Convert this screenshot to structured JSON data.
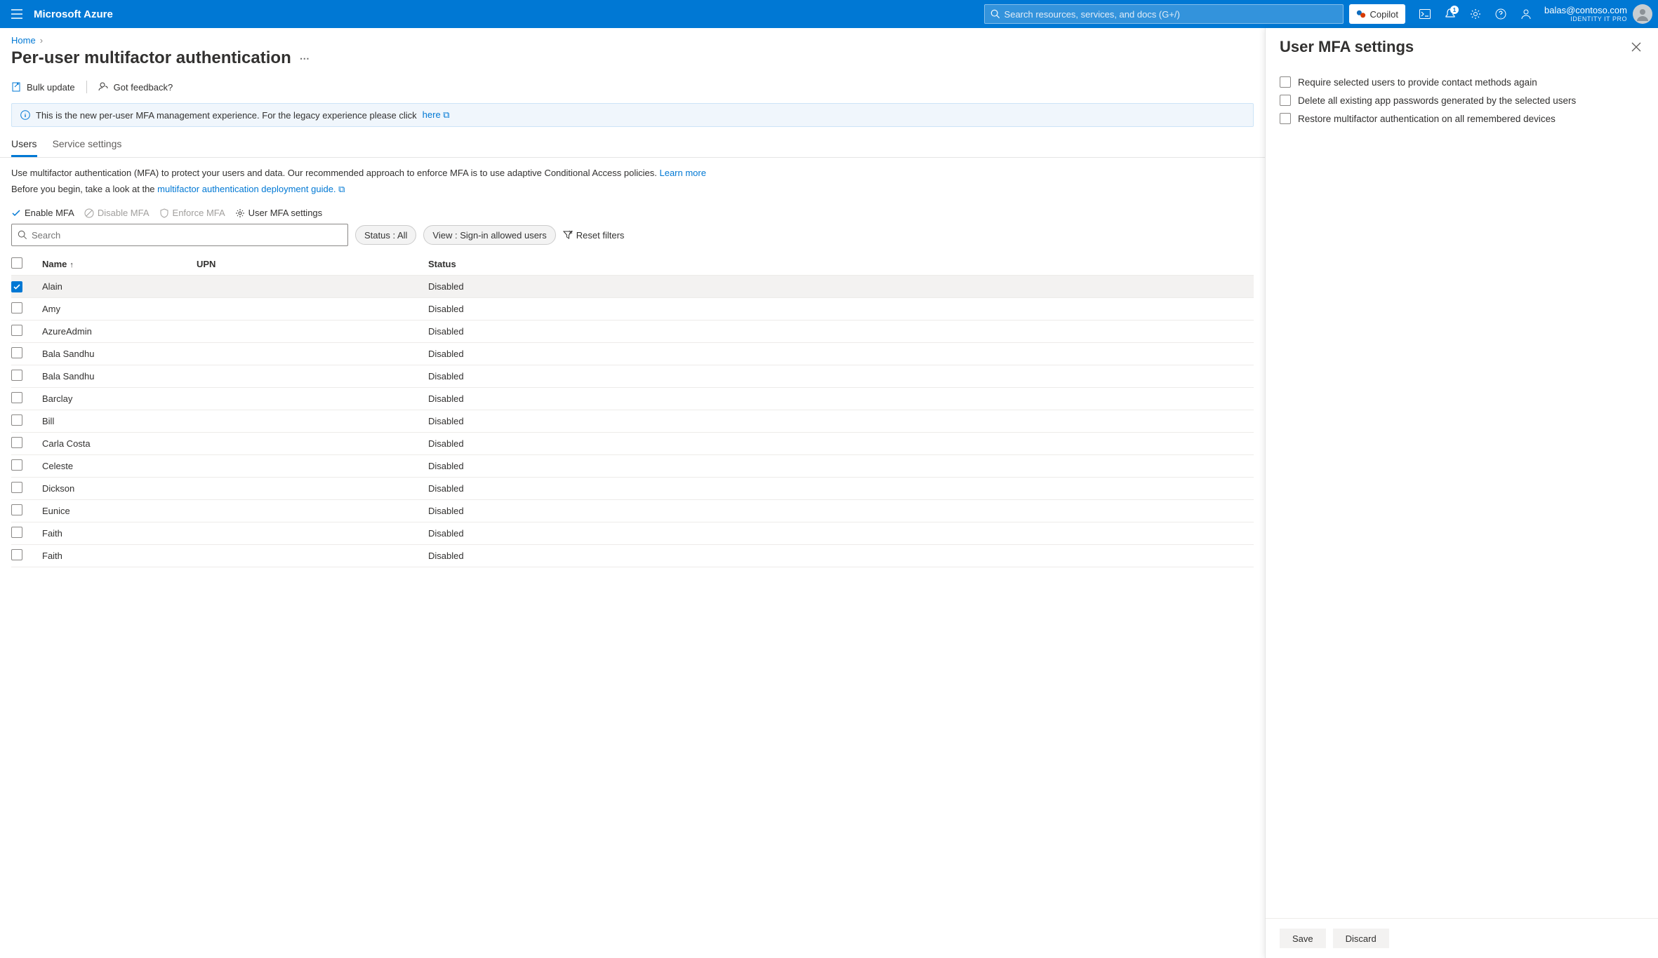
{
  "header": {
    "brand": "Microsoft Azure",
    "search_placeholder": "Search resources, services, and docs (G+/)",
    "copilot": "Copilot",
    "notification_badge": "1",
    "user_email": "balas@contoso.com",
    "user_role": "IDENTITY IT PRO"
  },
  "breadcrumb": {
    "home": "Home"
  },
  "page": {
    "title": "Per-user multifactor authentication"
  },
  "toolbar": {
    "bulk_update": "Bulk update",
    "feedback": "Got feedback?"
  },
  "banner": {
    "text_pre": "This is the new per-user MFA management experience. For the legacy experience please click",
    "link": "here"
  },
  "tabs": {
    "users": "Users",
    "service_settings": "Service settings"
  },
  "description": {
    "line1_pre": "Use multifactor authentication (MFA) to protect your users and data. Our recommended approach to enforce MFA is to use adaptive Conditional Access policies.",
    "line1_link": "Learn more",
    "line2_pre": "Before you begin, take a look at the",
    "line2_link": "multifactor authentication deployment guide."
  },
  "actions": {
    "enable": "Enable MFA",
    "disable": "Disable MFA",
    "enforce": "Enforce MFA",
    "settings": "User MFA settings"
  },
  "filters": {
    "search_placeholder": "Search",
    "status_pill": "Status : All",
    "view_pill": "View : Sign-in allowed users",
    "reset": "Reset filters"
  },
  "table": {
    "cols": {
      "name": "Name",
      "upn": "UPN",
      "status": "Status"
    },
    "rows": [
      {
        "name": "Alain",
        "upn": "",
        "status": "Disabled",
        "selected": true
      },
      {
        "name": "Amy",
        "upn": "",
        "status": "Disabled",
        "selected": false
      },
      {
        "name": "AzureAdmin",
        "upn": "",
        "status": "Disabled",
        "selected": false
      },
      {
        "name": "Bala Sandhu",
        "upn": "",
        "status": "Disabled",
        "selected": false
      },
      {
        "name": "Bala Sandhu",
        "upn": "",
        "status": "Disabled",
        "selected": false
      },
      {
        "name": "Barclay",
        "upn": "",
        "status": "Disabled",
        "selected": false
      },
      {
        "name": "Bill",
        "upn": "",
        "status": "Disabled",
        "selected": false
      },
      {
        "name": "Carla Costa",
        "upn": "",
        "status": "Disabled",
        "selected": false
      },
      {
        "name": "Celeste",
        "upn": "",
        "status": "Disabled",
        "selected": false
      },
      {
        "name": "Dickson",
        "upn": "",
        "status": "Disabled",
        "selected": false
      },
      {
        "name": "Eunice",
        "upn": "",
        "status": "Disabled",
        "selected": false
      },
      {
        "name": "Faith",
        "upn": "",
        "status": "Disabled",
        "selected": false
      },
      {
        "name": "Faith",
        "upn": "",
        "status": "Disabled",
        "selected": false
      }
    ]
  },
  "panel": {
    "title": "User MFA settings",
    "opt1": "Require selected users to provide contact methods again",
    "opt2": "Delete all existing app passwords generated by the selected users",
    "opt3": "Restore multifactor authentication on all remembered devices",
    "save": "Save",
    "discard": "Discard"
  }
}
